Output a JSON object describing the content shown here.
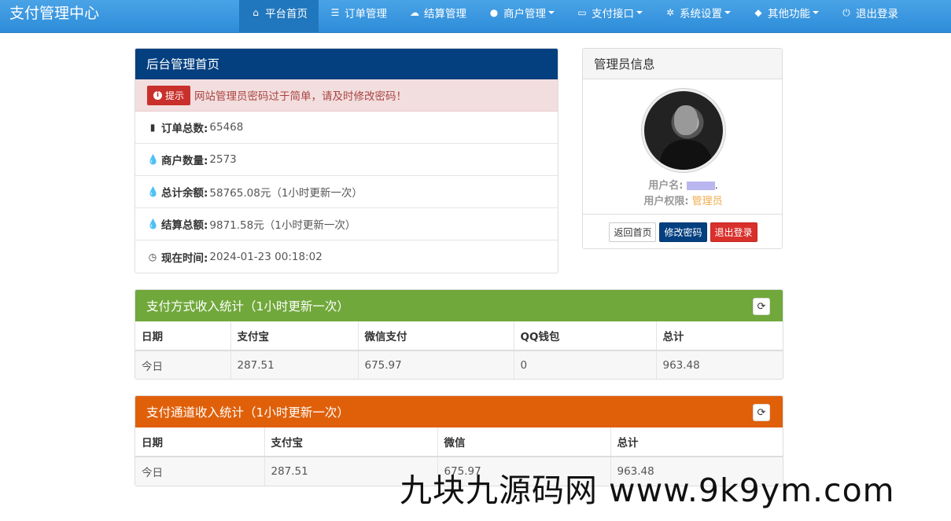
{
  "brand": "支付管理中心",
  "nav": [
    {
      "label": "平台首页",
      "icon": "home-icon",
      "glyph": "⌂",
      "active": true,
      "dropdown": false
    },
    {
      "label": "订单管理",
      "icon": "list-icon",
      "glyph": "☰",
      "active": false,
      "dropdown": false
    },
    {
      "label": "结算管理",
      "icon": "cloud-icon",
      "glyph": "☁",
      "active": false,
      "dropdown": false
    },
    {
      "label": "商户管理",
      "icon": "user-icon",
      "glyph": "●",
      "active": false,
      "dropdown": true
    },
    {
      "label": "支付接口",
      "icon": "card-icon",
      "glyph": "▭",
      "active": false,
      "dropdown": true
    },
    {
      "label": "系统设置",
      "icon": "gear-icon",
      "glyph": "✲",
      "active": false,
      "dropdown": true
    },
    {
      "label": "其他功能",
      "icon": "cube-icon",
      "glyph": "◆",
      "active": false,
      "dropdown": true
    },
    {
      "label": "退出登录",
      "icon": "power-icon",
      "glyph": "⏻",
      "active": false,
      "dropdown": false
    }
  ],
  "home": {
    "title": "后台管理首页",
    "alert_badge": "提示",
    "alert_text": "网站管理员密码过于简单，请及时修改密码！",
    "stats": [
      {
        "label": "订单总数:",
        "value": "65468",
        "icon": "bar-chart-icon",
        "glyph": "▮"
      },
      {
        "label": "商户数量:",
        "value": "2573",
        "icon": "drop-icon",
        "glyph": "💧"
      },
      {
        "label": "总计余额:",
        "value": "58765.08元（1小时更新一次）",
        "icon": "drop-icon",
        "glyph": "💧"
      },
      {
        "label": "结算总额:",
        "value": "9871.58元（1小时更新一次）",
        "icon": "drop-icon",
        "glyph": "💧"
      },
      {
        "label": "现在时间:",
        "value": "2024-01-23 00:18:02",
        "icon": "clock-icon",
        "glyph": "◷"
      }
    ]
  },
  "admin": {
    "title": "管理员信息",
    "username_label": "用户名:",
    "username_suffix": ".",
    "role_label": "用户权限:",
    "role_value": "管理员",
    "btn_home": "返回首页",
    "btn_password": "修改密码",
    "btn_logout": "退出登录"
  },
  "pay_method": {
    "title": "支付方式收入统计（1小时更新一次）",
    "headers": [
      "日期",
      "支付宝",
      "微信支付",
      "QQ钱包",
      "总计"
    ],
    "rows": [
      [
        "今日",
        "287.51",
        "675.97",
        "0",
        "963.48"
      ]
    ]
  },
  "pay_channel": {
    "title": "支付通道收入统计（1小时更新一次）",
    "headers": [
      "日期",
      "支付宝",
      "微信",
      "总计"
    ],
    "rows": [
      [
        "今日",
        "287.51",
        "675.97",
        "963.48"
      ]
    ]
  },
  "watermark": "九块九源码网 www.9k9ym.com",
  "colors": {
    "navbar": "#2d8cd9",
    "home_heading": "#044080",
    "pay_method_heading": "#70a83b",
    "pay_channel_heading": "#e0600a"
  }
}
